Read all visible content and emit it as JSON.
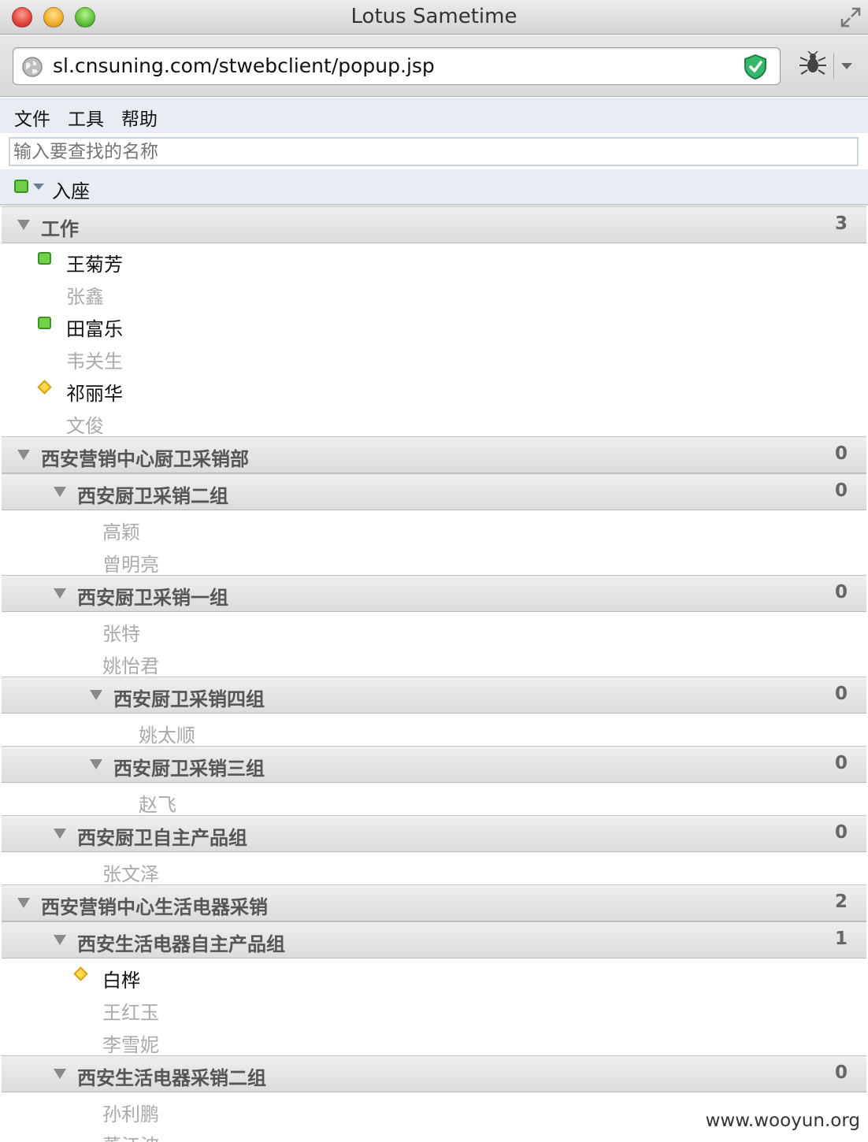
{
  "window": {
    "title": "Lotus Sametime"
  },
  "browser": {
    "url": "sl.cnsuning.com/stwebclient/popup.jsp"
  },
  "menu": {
    "items": [
      "文件",
      "工具",
      "帮助"
    ]
  },
  "search": {
    "placeholder": "输入要查找的名称"
  },
  "status": {
    "label": "入座",
    "color": "#6fcf4a"
  },
  "colors": {
    "online_text": "#111111",
    "offline_text": "#aaaaaa",
    "available": "#71d24a",
    "away": "#ffd94a"
  },
  "contacts": {
    "groups": [
      {
        "name": "工作",
        "count": "3"
      },
      {
        "name": "西安营销中心厨卫采销部",
        "count": "0"
      },
      {
        "name": "西安厨卫采销二组",
        "count": "0"
      },
      {
        "name": "西安厨卫采销一组",
        "count": "0"
      },
      {
        "name": "西安厨卫采销四组",
        "count": "0"
      },
      {
        "name": "西安厨卫采销三组",
        "count": "0"
      },
      {
        "name": "西安厨卫自主产品组",
        "count": "0"
      },
      {
        "name": "西安营销中心生活电器采销",
        "count": "2"
      },
      {
        "name": "西安生活电器自主产品组",
        "count": "1"
      },
      {
        "name": "西安生活电器采销二组",
        "count": "0"
      }
    ],
    "people": [
      {
        "name": "王菊芳",
        "status": "available"
      },
      {
        "name": "张鑫",
        "status": "offline"
      },
      {
        "name": "田富乐",
        "status": "available"
      },
      {
        "name": "韦关生",
        "status": "offline"
      },
      {
        "name": "祁丽华",
        "status": "away"
      },
      {
        "name": "文俊",
        "status": "offline"
      },
      {
        "name": "高颖",
        "status": "offline"
      },
      {
        "name": "曾明亮",
        "status": "offline"
      },
      {
        "name": "张特",
        "status": "offline"
      },
      {
        "name": "姚怡君",
        "status": "offline"
      },
      {
        "name": "姚太顺",
        "status": "offline"
      },
      {
        "name": "赵飞",
        "status": "offline"
      },
      {
        "name": "张文泽",
        "status": "offline"
      },
      {
        "name": "白桦",
        "status": "away"
      },
      {
        "name": "王红玉",
        "status": "offline"
      },
      {
        "name": "李雪妮",
        "status": "offline"
      },
      {
        "name": "孙利鹏",
        "status": "offline"
      },
      {
        "name": "董江波",
        "status": "offline"
      }
    ]
  },
  "watermark": "www.wooyun.org"
}
